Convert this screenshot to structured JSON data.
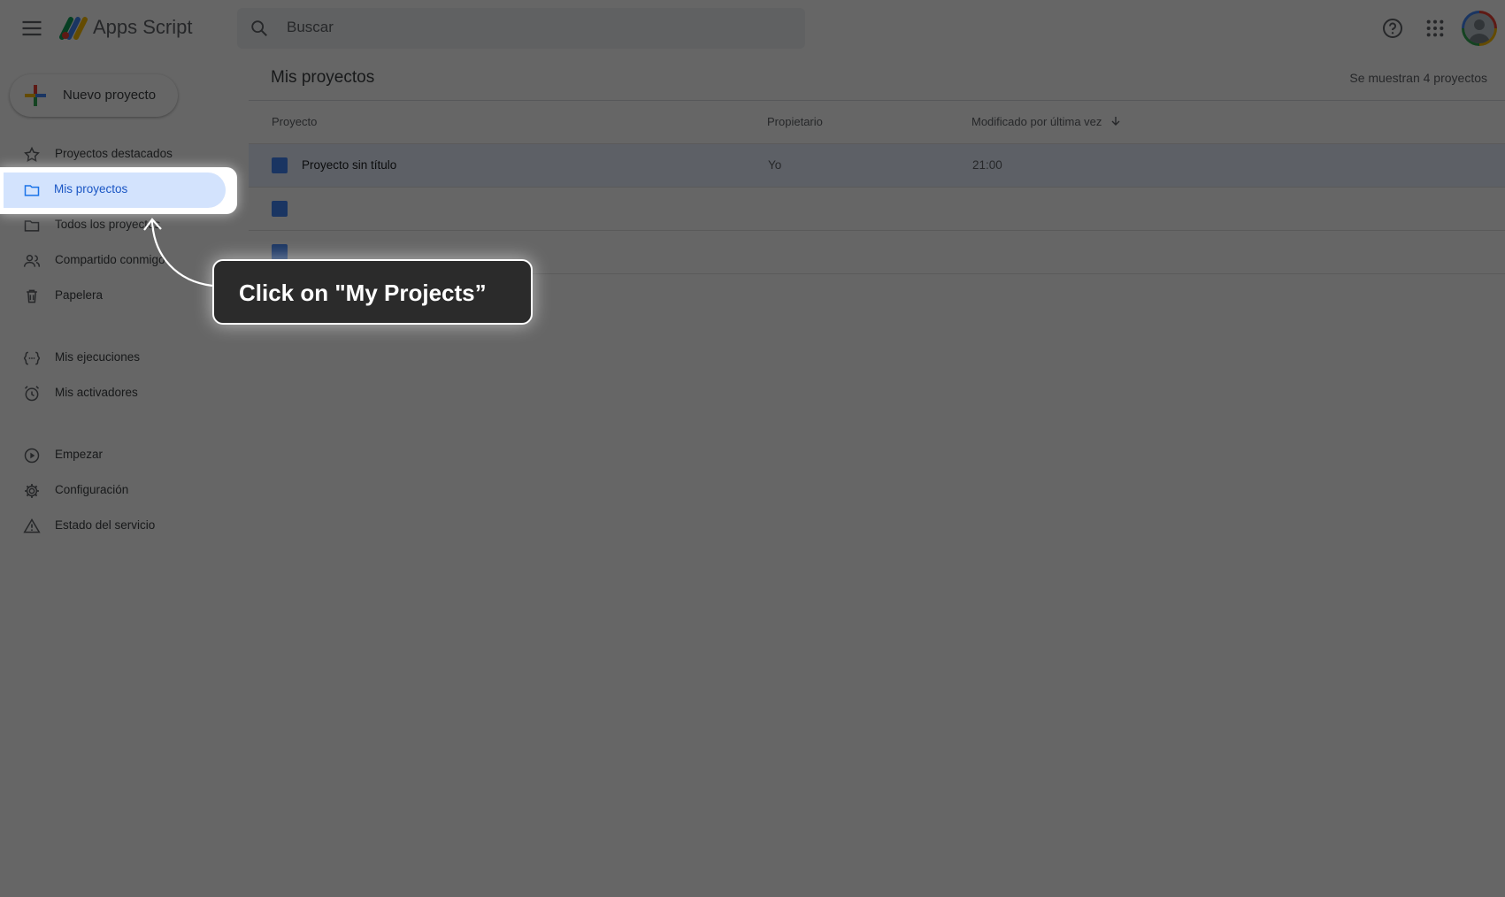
{
  "app": {
    "title": "Apps Script"
  },
  "search": {
    "placeholder": "Buscar"
  },
  "sidebar": {
    "new_project": "Nuevo proyecto",
    "items": [
      {
        "label": "Proyectos destacados",
        "icon": "star-icon"
      },
      {
        "label": "Mis proyectos",
        "icon": "folder-icon",
        "selected": true
      },
      {
        "label": "Todos los proyectos",
        "icon": "folder-icon"
      },
      {
        "label": "Compartido conmigo",
        "icon": "people-icon"
      },
      {
        "label": "Papelera",
        "icon": "trash-icon"
      },
      {
        "label": "Mis ejecuciones",
        "icon": "executions-icon"
      },
      {
        "label": "Mis activadores",
        "icon": "alarm-icon"
      },
      {
        "label": "Empezar",
        "icon": "play-circle-icon"
      },
      {
        "label": "Configuración",
        "icon": "gear-icon"
      },
      {
        "label": "Estado del servicio",
        "icon": "warning-icon"
      }
    ]
  },
  "main": {
    "title": "Mis proyectos",
    "count_text": "Se muestran 4 proyectos",
    "columns": {
      "project": "Proyecto",
      "owner": "Propietario",
      "modified": "Modificado por última vez"
    },
    "rows": [
      {
        "name": "Proyecto sin título",
        "owner": "Yo",
        "modified": "21:00"
      }
    ]
  },
  "tour": {
    "callout_text": "Click on \"My Projects”"
  },
  "colors": {
    "accent": "#1a73e8",
    "selected_bg": "#d3e3fd",
    "overlay": "rgba(0,0,0,0.6)",
    "callout_bg": "#2b2b2b"
  }
}
